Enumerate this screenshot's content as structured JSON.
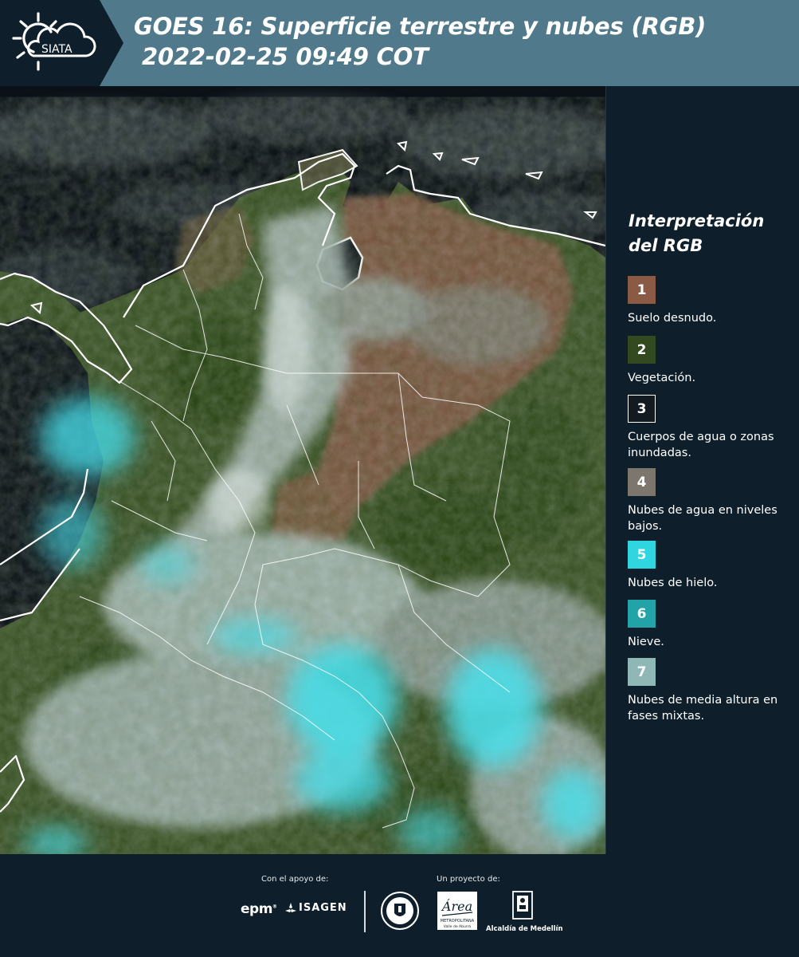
{
  "header": {
    "logo_text": "SIATA",
    "title_line1": "GOES 16: Superficie terrestre y nubes (RGB)",
    "title_line2": "2022-02-25 09:49 COT"
  },
  "legend": {
    "title_line1": "Interpretación",
    "title_line2": "del RGB",
    "items": [
      {
        "number": "1",
        "label": "Suelo desnudo.",
        "color": "#8a5a45",
        "border": "#8a5a45"
      },
      {
        "number": "2",
        "label": "Vegetación.",
        "color": "#33491f",
        "border": "#33491f"
      },
      {
        "number": "3",
        "label": "Cuerpos de agua o zonas inundadas.",
        "color": "#131a20",
        "border": "#ffffff"
      },
      {
        "number": "4",
        "label": "Nubes de agua en niveles bajos.",
        "color": "#7d766d",
        "border": "#7d766d"
      },
      {
        "number": "5",
        "label": "Nubes de hielo.",
        "color": "#2fd6e0",
        "border": "#2fd6e0"
      },
      {
        "number": "6",
        "label": "Nieve.",
        "color": "#22a3a8",
        "border": "#22a3a8"
      },
      {
        "number": "7",
        "label": "Nubes de media altura en fases mixtas.",
        "color": "#8eb7b6",
        "border": "#8eb7b6"
      }
    ]
  },
  "footer": {
    "support_label": "Con el apoyo de:",
    "project_label": "Un proyecto de:",
    "sponsor_1": "epm",
    "sponsor_2": "ISAGEN",
    "area_text": "Área",
    "area_sub": "METROPOLITANA",
    "area_sub2": "Valle de Aburrá",
    "alcaldia_text": "Alcaldía de Medellín"
  },
  "map": {
    "colors": {
      "ocean": "#0b1116",
      "soil": "#74533e",
      "vegetation": "#3a5226",
      "cloud_low": "#8f968f",
      "cloud_ice": "#3fd7e3",
      "cloud_mid": "#a9c6c4",
      "border": "#ffffff"
    }
  }
}
